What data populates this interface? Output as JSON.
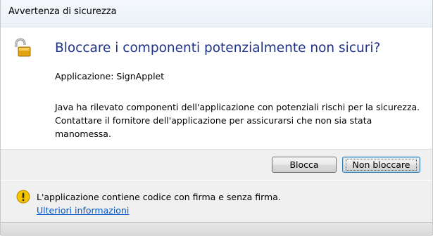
{
  "window": {
    "title": "Avvertenza di sicurezza"
  },
  "dialog": {
    "heading": "Bloccare i componenti potenzialmente non sicuri?",
    "application_line": "Applicazione: SignApplet",
    "description": "Java ha rilevato componenti dell'applicazione con potenziali rischi per la sicurezza. Contattare il fornitore dell'applicazione per assicurarsi che non sia stata manomessa.",
    "icon": "lock-icon"
  },
  "buttons": {
    "block_label": "Blocca",
    "dont_block_label": "Non bloccare"
  },
  "footer": {
    "warning_text": "L'applicazione contiene codice con firma e senza firma.",
    "more_info_link": "Ulteriori informazioni",
    "icon": "warning-icon"
  },
  "colors": {
    "heading": "#1e3287",
    "link": "#0055cc",
    "warning_yellow": "#f5c400"
  }
}
